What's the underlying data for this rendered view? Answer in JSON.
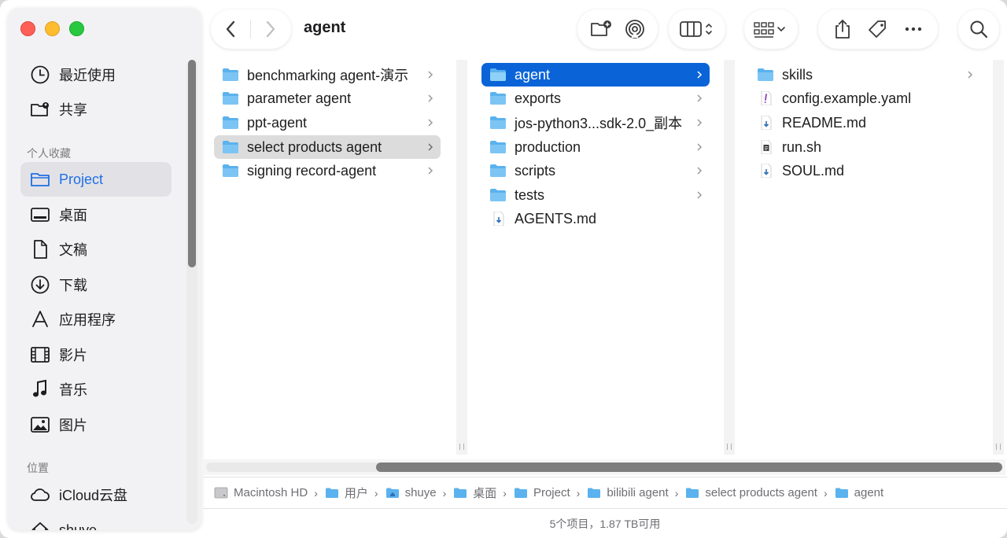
{
  "window": {
    "title": "agent"
  },
  "sidebar": {
    "recents_label": "最近使用",
    "shared_label": "共享",
    "favorites_header": "个人收藏",
    "favorites": [
      {
        "label": "Project",
        "icon": "folder-icon"
      },
      {
        "label": "桌面",
        "icon": "desktop-icon"
      },
      {
        "label": "文稿",
        "icon": "document-icon"
      },
      {
        "label": "下载",
        "icon": "download-icon"
      },
      {
        "label": "应用程序",
        "icon": "applications-icon"
      },
      {
        "label": "影片",
        "icon": "film-icon"
      },
      {
        "label": "音乐",
        "icon": "music-icon"
      },
      {
        "label": "图片",
        "icon": "photo-icon"
      }
    ],
    "locations_header": "位置",
    "locations": [
      {
        "label": "iCloud云盘",
        "icon": "cloud-icon"
      },
      {
        "label": "shuye",
        "icon": "home-icon"
      }
    ]
  },
  "columns": {
    "col1": [
      {
        "label": "benchmarking agent-演示",
        "kind": "folder"
      },
      {
        "label": "parameter agent",
        "kind": "folder"
      },
      {
        "label": "ppt-agent",
        "kind": "folder"
      },
      {
        "label": "select products agent",
        "kind": "folder"
      },
      {
        "label": "signing record-agent",
        "kind": "folder"
      }
    ],
    "col2": [
      {
        "label": "agent",
        "kind": "folder"
      },
      {
        "label": "exports",
        "kind": "folder"
      },
      {
        "label": "jos-python3...sdk-2.0_副本",
        "kind": "folder"
      },
      {
        "label": "production",
        "kind": "folder"
      },
      {
        "label": "scripts",
        "kind": "folder"
      },
      {
        "label": "tests",
        "kind": "folder"
      },
      {
        "label": "AGENTS.md",
        "kind": "file"
      }
    ],
    "col3": [
      {
        "label": "skills",
        "kind": "folder"
      },
      {
        "label": "config.example.yaml",
        "kind": "file"
      },
      {
        "label": "README.md",
        "kind": "file"
      },
      {
        "label": "run.sh",
        "kind": "file"
      },
      {
        "label": "SOUL.md",
        "kind": "file"
      }
    ]
  },
  "pathbar": [
    {
      "label": "Macintosh HD"
    },
    {
      "label": "用户"
    },
    {
      "label": "shuye"
    },
    {
      "label": "桌面"
    },
    {
      "label": "Project"
    },
    {
      "label": "bilibili agent"
    },
    {
      "label": "select products agent"
    },
    {
      "label": "agent"
    }
  ],
  "status": {
    "text": "5个项目，1.87 TB可用"
  },
  "colors": {
    "accent": "#0a64d8",
    "sidebar_active_text": "#1f6fe5",
    "folder": "#5ab2ee"
  }
}
